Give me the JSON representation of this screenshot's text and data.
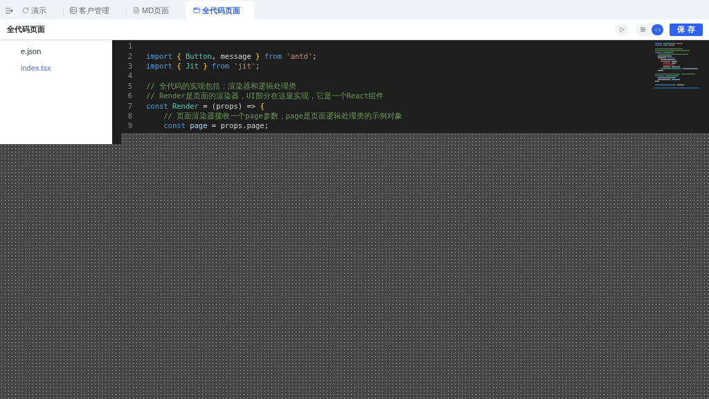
{
  "tab_bar": {
    "tabs": [
      {
        "label": "演示",
        "selected": false
      },
      {
        "label": "客户管理",
        "selected": false
      },
      {
        "label": "MD页面",
        "selected": false
      },
      {
        "label": "全代码页面",
        "selected": true
      }
    ]
  },
  "header": {
    "title": "全代码页面",
    "view_toggle": [
      {
        "selected": false
      },
      {
        "selected": true
      }
    ],
    "save_button": "保 存"
  },
  "file_tree": {
    "files": [
      {
        "name": "e.json",
        "selected": false
      },
      {
        "name": "index.tsx",
        "selected": true
      }
    ]
  },
  "editor": {
    "lines": [
      {
        "number": "1"
      },
      {
        "number": "2",
        "tokens": [
          {
            "kind": "keyword",
            "text": "import"
          },
          {
            "kind": "bracket",
            "text": " {"
          },
          {
            "kind": "class",
            "text": " Button"
          },
          {
            "kind": "plain",
            "text": ", message "
          },
          {
            "kind": "bracket",
            "text": "}"
          },
          {
            "kind": "keyword",
            "text": " from"
          },
          {
            "kind": "string",
            "text": " 'antd'"
          },
          {
            "kind": "plain",
            "text": ";"
          }
        ]
      },
      {
        "number": "3",
        "tokens": [
          {
            "kind": "keyword",
            "text": "import"
          },
          {
            "kind": "bracket",
            "text": " {"
          },
          {
            "kind": "class",
            "text": " Jit"
          },
          {
            "kind": "bracket",
            "text": " }"
          },
          {
            "kind": "keyword",
            "text": " from"
          },
          {
            "kind": "string",
            "text": " 'jit'"
          },
          {
            "kind": "plain",
            "text": ";"
          }
        ]
      },
      {
        "number": "4"
      },
      {
        "number": "5",
        "tokens": [
          {
            "kind": "comment",
            "text": "// 全代码的实现包括：渲染器和逻辑处理类"
          }
        ]
      },
      {
        "number": "6",
        "tokens": [
          {
            "kind": "comment",
            "text": "// Render是页面的渲染器，UI部分在这里实现，它是一个React组件"
          }
        ]
      },
      {
        "number": "7",
        "tokens": [
          {
            "kind": "keyword",
            "text": "const"
          },
          {
            "kind": "class",
            "text": " Render"
          },
          {
            "kind": "plain",
            "text": " = (props) => "
          },
          {
            "kind": "bracket",
            "text": "{"
          }
        ]
      },
      {
        "number": "8",
        "tokens": [
          {
            "kind": "comment",
            "text": "    // 页面渲染器接收一个page参数，page是页面逻辑处理类的示例对象"
          }
        ]
      },
      {
        "number": "9",
        "tokens": [
          {
            "kind": "keyword",
            "text": "    const"
          },
          {
            "kind": "variable",
            "text": " page"
          },
          {
            "kind": "plain",
            "text": " = props.page;"
          }
        ]
      }
    ]
  }
}
